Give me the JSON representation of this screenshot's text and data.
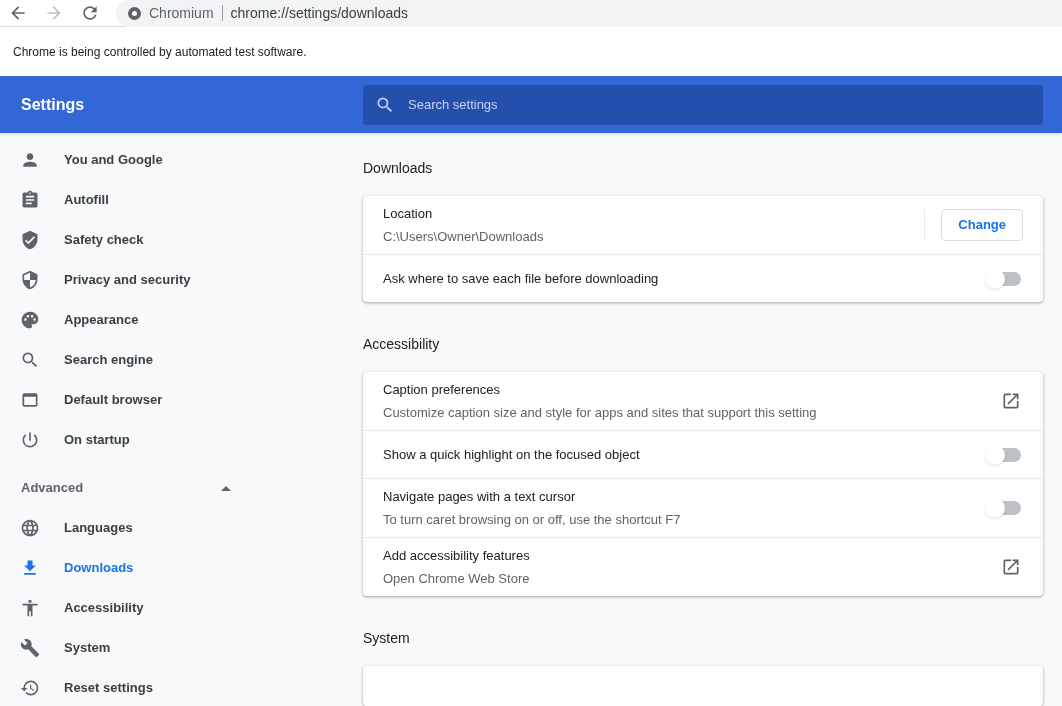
{
  "browser": {
    "site_label": "Chromium",
    "url": "chrome://settings/downloads"
  },
  "infobar": "Chrome is being controlled by automated test software.",
  "header": {
    "title": "Settings",
    "search": {
      "placeholder": "Search settings"
    }
  },
  "sidebar": {
    "items": [
      {
        "label": "You and Google",
        "selected": false
      },
      {
        "label": "Autofill",
        "selected": false
      },
      {
        "label": "Safety check",
        "selected": false
      },
      {
        "label": "Privacy and security",
        "selected": false
      },
      {
        "label": "Appearance",
        "selected": false
      },
      {
        "label": "Search engine",
        "selected": false
      },
      {
        "label": "Default browser",
        "selected": false
      },
      {
        "label": "On startup",
        "selected": false
      }
    ],
    "advanced": {
      "label": "Advanced",
      "expanded": true,
      "items": [
        {
          "label": "Languages",
          "selected": false
        },
        {
          "label": "Downloads",
          "selected": true
        },
        {
          "label": "Accessibility",
          "selected": false
        },
        {
          "label": "System",
          "selected": false
        },
        {
          "label": "Reset settings",
          "selected": false
        }
      ]
    }
  },
  "sections": [
    {
      "title": "Downloads",
      "rows": [
        {
          "kind": "button",
          "label": "Location",
          "sublabel": "C:\\Users\\Owner\\Downloads",
          "button": "Change"
        },
        {
          "kind": "toggle",
          "label": "Ask where to save each file before downloading",
          "on": false
        }
      ]
    },
    {
      "title": "Accessibility",
      "rows": [
        {
          "kind": "link",
          "label": "Caption preferences",
          "sublabel": "Customize caption size and style for apps and sites that support this setting"
        },
        {
          "kind": "toggle",
          "label": "Show a quick highlight on the focused object",
          "on": false
        },
        {
          "kind": "toggle",
          "label": "Navigate pages with a text cursor",
          "sublabel": "To turn caret browsing on or off, use the shortcut F7",
          "on": false
        },
        {
          "kind": "link",
          "label": "Add accessibility features",
          "sublabel": "Open Chrome Web Store"
        }
      ]
    },
    {
      "title": "System"
    }
  ]
}
